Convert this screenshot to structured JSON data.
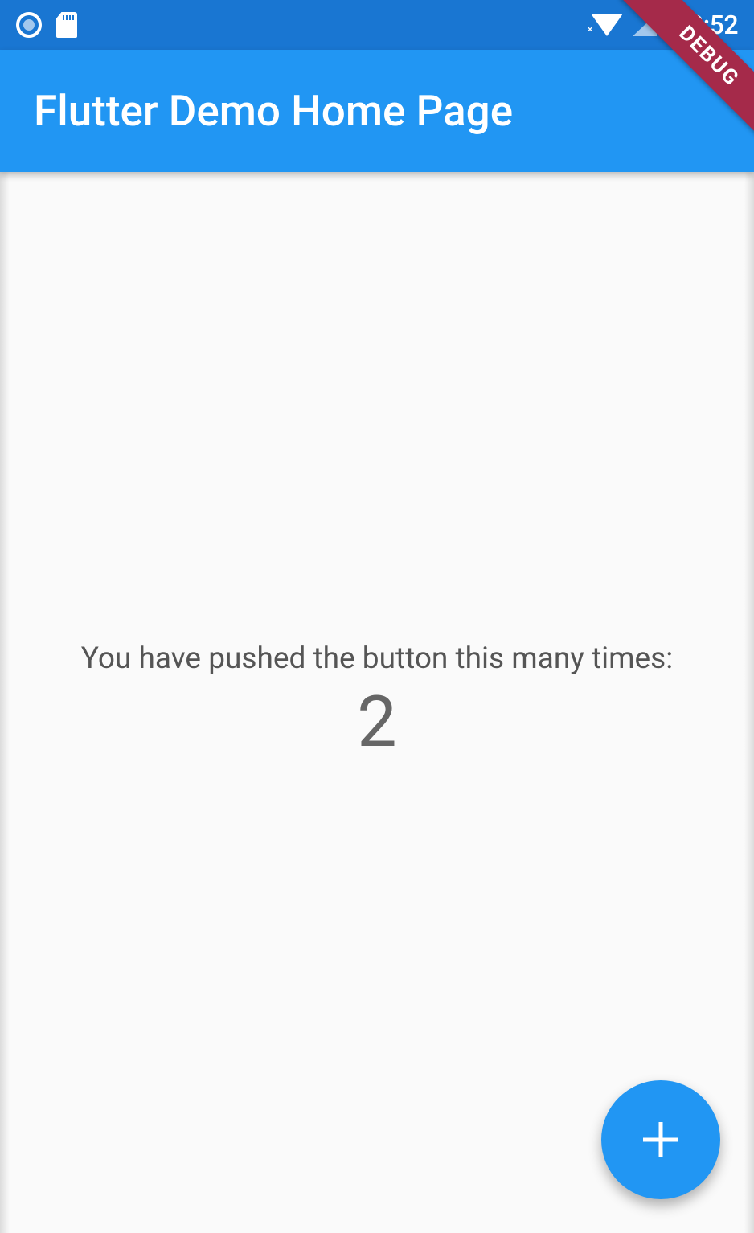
{
  "status_bar": {
    "clock": "8:52"
  },
  "debug_banner": {
    "label": "DEBUG"
  },
  "app_bar": {
    "title": "Flutter Demo Home Page"
  },
  "body": {
    "push_text": "You have pushed the button this many times:",
    "counter_value": "2"
  },
  "fab": {
    "icon_name": "add-icon"
  },
  "colors": {
    "primary": "#2196f3",
    "primary_dark": "#1976d2",
    "debug_banner": "#a52a4a",
    "background": "#fafafa"
  }
}
